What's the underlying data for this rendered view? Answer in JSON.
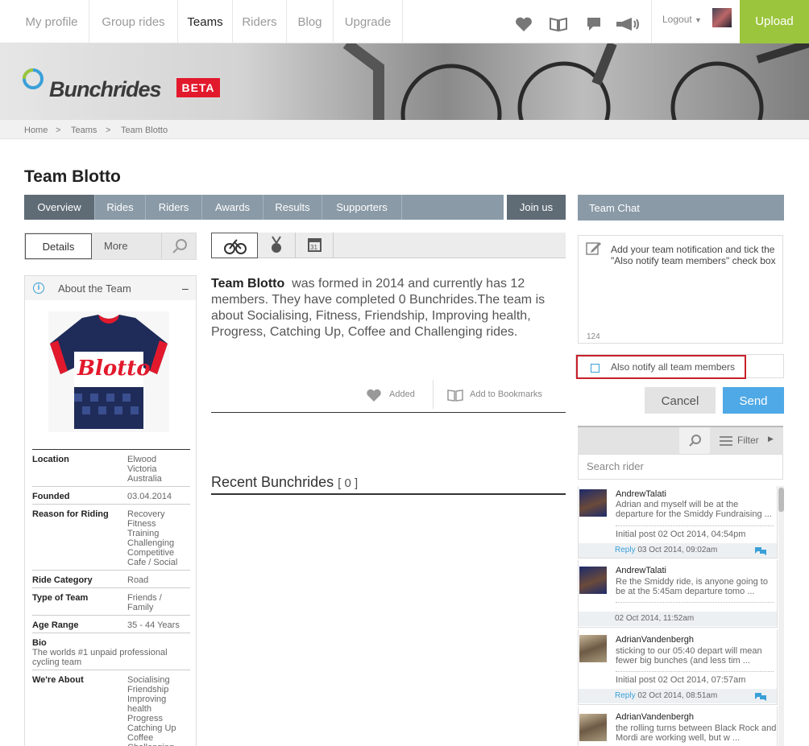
{
  "nav": {
    "links": [
      "My profile",
      "Group rides",
      "Teams",
      "Riders",
      "Blog",
      "Upgrade"
    ],
    "active": "Teams",
    "logout_label": "Logout",
    "upload_label": "Upload"
  },
  "banner": {
    "brand": "Bunchrides",
    "badge": "BETA"
  },
  "breadcrumb": [
    "Home",
    "Teams",
    "Team Blotto"
  ],
  "breadcrumb_sep": ">",
  "page_title": "Team Blotto",
  "tabs": [
    "Overview",
    "Rides",
    "Riders",
    "Awards",
    "Results",
    "Supporters"
  ],
  "join_label": "Join us",
  "left": {
    "subtabs": {
      "details": "Details",
      "more": "More"
    },
    "about_title": "About the Team",
    "collapse": "–",
    "jersey_text": "Blotto",
    "fields": [
      {
        "label": "Location",
        "value": "Elwood\nVictoria\nAustralia"
      },
      {
        "label": "Founded",
        "value": "03.04.2014"
      },
      {
        "label": "Reason for Riding",
        "value": "Recovery\nFitness\nTraining\nChallenging\nCompetitive\nCafe / Social"
      },
      {
        "label": "Ride Category",
        "value": "Road"
      },
      {
        "label": "Type of Team",
        "value": "Friends /\nFamily"
      },
      {
        "label": "Age Range",
        "value": "35 - 44 Years"
      },
      {
        "label": "Bio",
        "value": "The worlds #1 unpaid professional\ncycling team"
      },
      {
        "label": "We're About",
        "value": "Socialising\nFriendship\nImproving\nhealth\nProgress\nCatching Up\nCoffee\nChallenging"
      }
    ]
  },
  "center": {
    "team_name": "Team Blotto",
    "description": "was formed in 2014 and currently has 12 members. They have completed 0 Bunchrides.The team is about Socialising, Fitness, Friendship, Improving health, Progress, Catching Up, Coffee and Challenging rides.",
    "added_label": "Added",
    "bookmark_label": "Add to Bookmarks",
    "recent_label": "Recent Bunchrides",
    "recent_count": "[ 0 ]"
  },
  "chat": {
    "title": "Team Chat",
    "placeholder": "Add your team notification and tick the \"Also notify team members\" check box",
    "char_count": "124",
    "notify_label": "Also notify all team members",
    "cancel_label": "Cancel",
    "send_label": "Send",
    "filter_label": "Filter",
    "search_placeholder": "Search rider",
    "posts": [
      {
        "name": "AndrewTalati",
        "text": "Adrian and myself will be at the departure for the Smiddy Fundraising ...",
        "initial": "Initial post 02 Oct 2014, 04:54pm",
        "reply": "Reply",
        "time": "03 Oct 2014, 09:02am"
      },
      {
        "name": "AndrewTalati",
        "text": "Re the Smiddy ride, is anyone going to be at the 5:45am departure tomo ...",
        "initial": "",
        "reply": "",
        "time": "02 Oct 2014, 11:52am"
      },
      {
        "name": "AdrianVandenbergh",
        "text": "sticking to our 05:40 depart will mean fewer big bunches (and less tim ...",
        "initial": "Initial post 02 Oct 2014, 07:57am",
        "reply": "Reply",
        "time": "02 Oct 2014, 08:51am"
      },
      {
        "name": "AdrianVandenbergh",
        "text": "the rolling turns between Black Rock and Mordi are working well, but w ...",
        "initial": "",
        "reply": "",
        "time": ""
      }
    ]
  },
  "colors": {
    "accent_green": "#9bc53d",
    "beta_red": "#e2192c",
    "tab_blue_grey": "#8a9aa7",
    "send_blue": "#4fa9e6"
  }
}
